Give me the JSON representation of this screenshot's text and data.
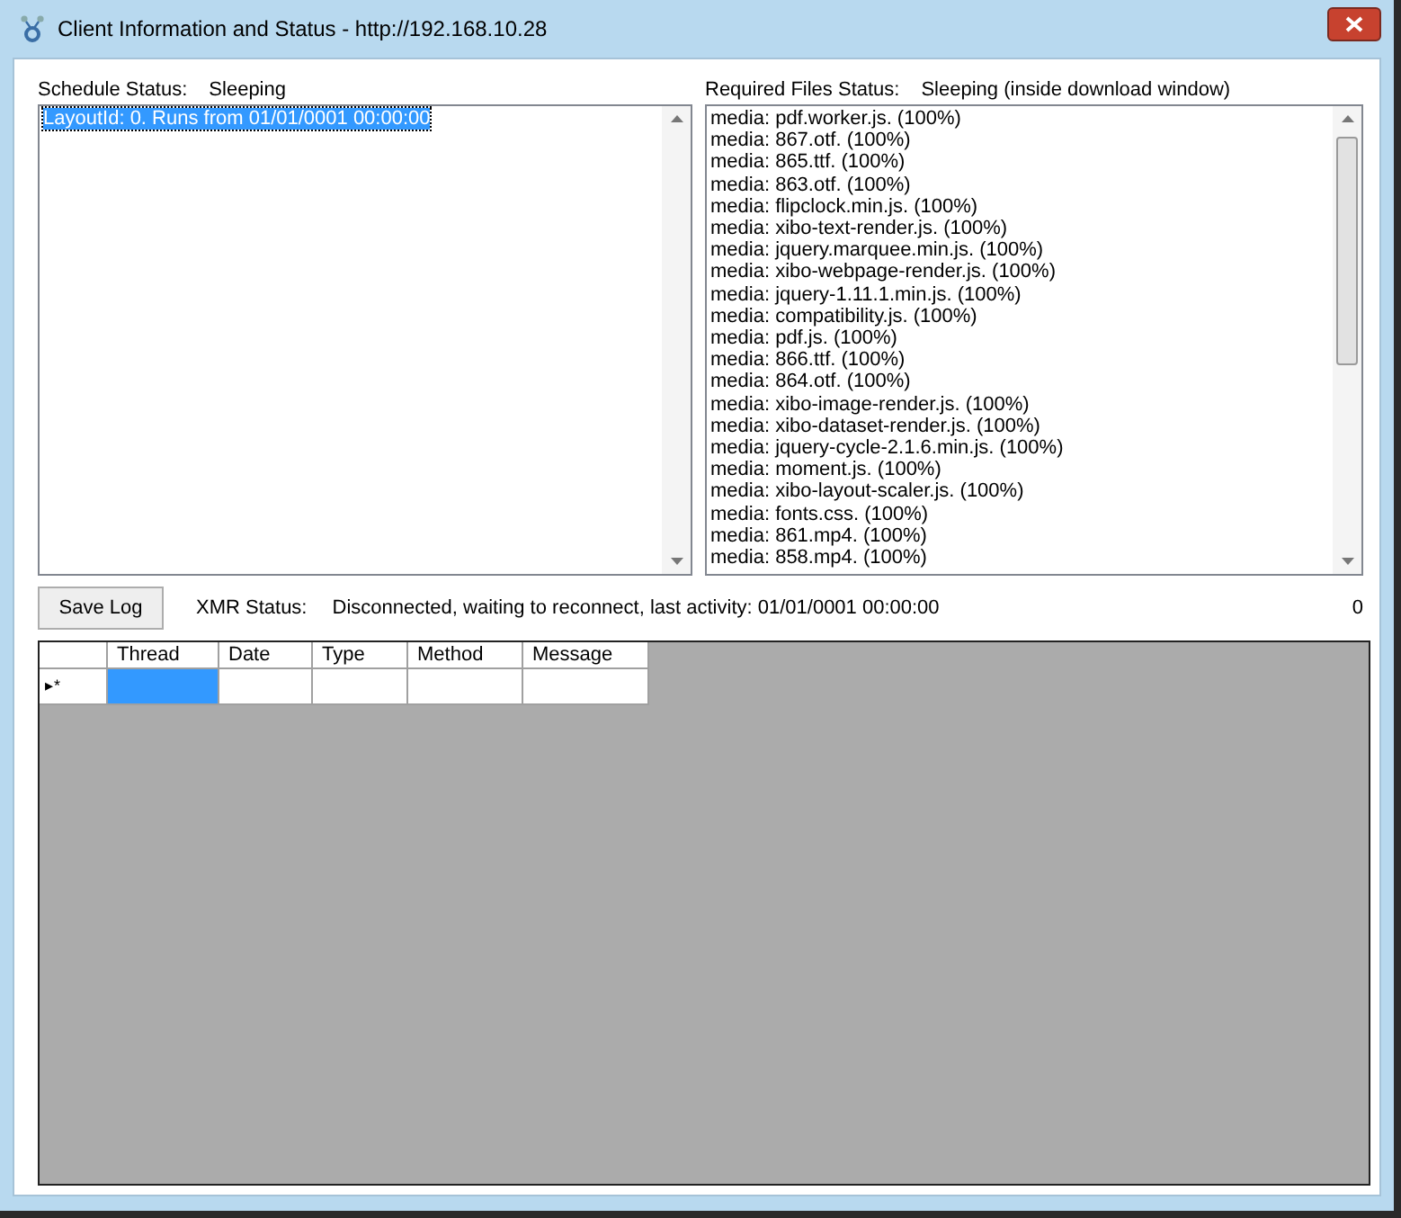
{
  "window": {
    "title": "Client Information and Status - http://192.168.10.28"
  },
  "schedule": {
    "label": "Schedule Status:",
    "value": "Sleeping",
    "items": [
      {
        "text": "LayoutId: 0. Runs from 01/01/0001 00:00:00",
        "selected": true
      }
    ]
  },
  "required_files": {
    "label": "Required Files Status:",
    "value": "Sleeping (inside download window)",
    "items": [
      {
        "text": "media: pdf.worker.js. (100%)",
        "selected": false
      },
      {
        "text": "media: 867.otf. (100%)",
        "selected": false
      },
      {
        "text": "media: 865.ttf. (100%)",
        "selected": false
      },
      {
        "text": "media: 863.otf. (100%)",
        "selected": false
      },
      {
        "text": "media: flipclock.min.js. (100%)",
        "selected": false
      },
      {
        "text": "media: xibo-text-render.js. (100%)",
        "selected": false
      },
      {
        "text": "media: jquery.marquee.min.js. (100%)",
        "selected": false
      },
      {
        "text": "media: xibo-webpage-render.js. (100%)",
        "selected": false
      },
      {
        "text": "media: jquery-1.11.1.min.js. (100%)",
        "selected": false
      },
      {
        "text": "media: compatibility.js. (100%)",
        "selected": false
      },
      {
        "text": "media: pdf.js. (100%)",
        "selected": false
      },
      {
        "text": "media: 866.ttf. (100%)",
        "selected": false
      },
      {
        "text": "media: 864.otf. (100%)",
        "selected": false
      },
      {
        "text": "media: xibo-image-render.js. (100%)",
        "selected": false
      },
      {
        "text": "media: xibo-dataset-render.js. (100%)",
        "selected": false
      },
      {
        "text": "media: jquery-cycle-2.1.6.min.js. (100%)",
        "selected": false
      },
      {
        "text": "media: moment.js. (100%)",
        "selected": false
      },
      {
        "text": "media: xibo-layout-scaler.js. (100%)",
        "selected": false
      },
      {
        "text": "media: fonts.css. (100%)",
        "selected": false
      },
      {
        "text": "media: 861.mp4. (100%)",
        "selected": false
      },
      {
        "text": "media: 858.mp4. (100%)",
        "selected": false
      }
    ]
  },
  "save_log_button": "Save Log",
  "xmr": {
    "label": "XMR Status:",
    "value": "Disconnected, waiting to reconnect, last activity: 01/01/0001 00:00:00",
    "count": "0"
  },
  "log_table": {
    "columns": [
      "Thread",
      "Date",
      "Type",
      "Method",
      "Message"
    ],
    "new_row_marker": "▸*"
  }
}
